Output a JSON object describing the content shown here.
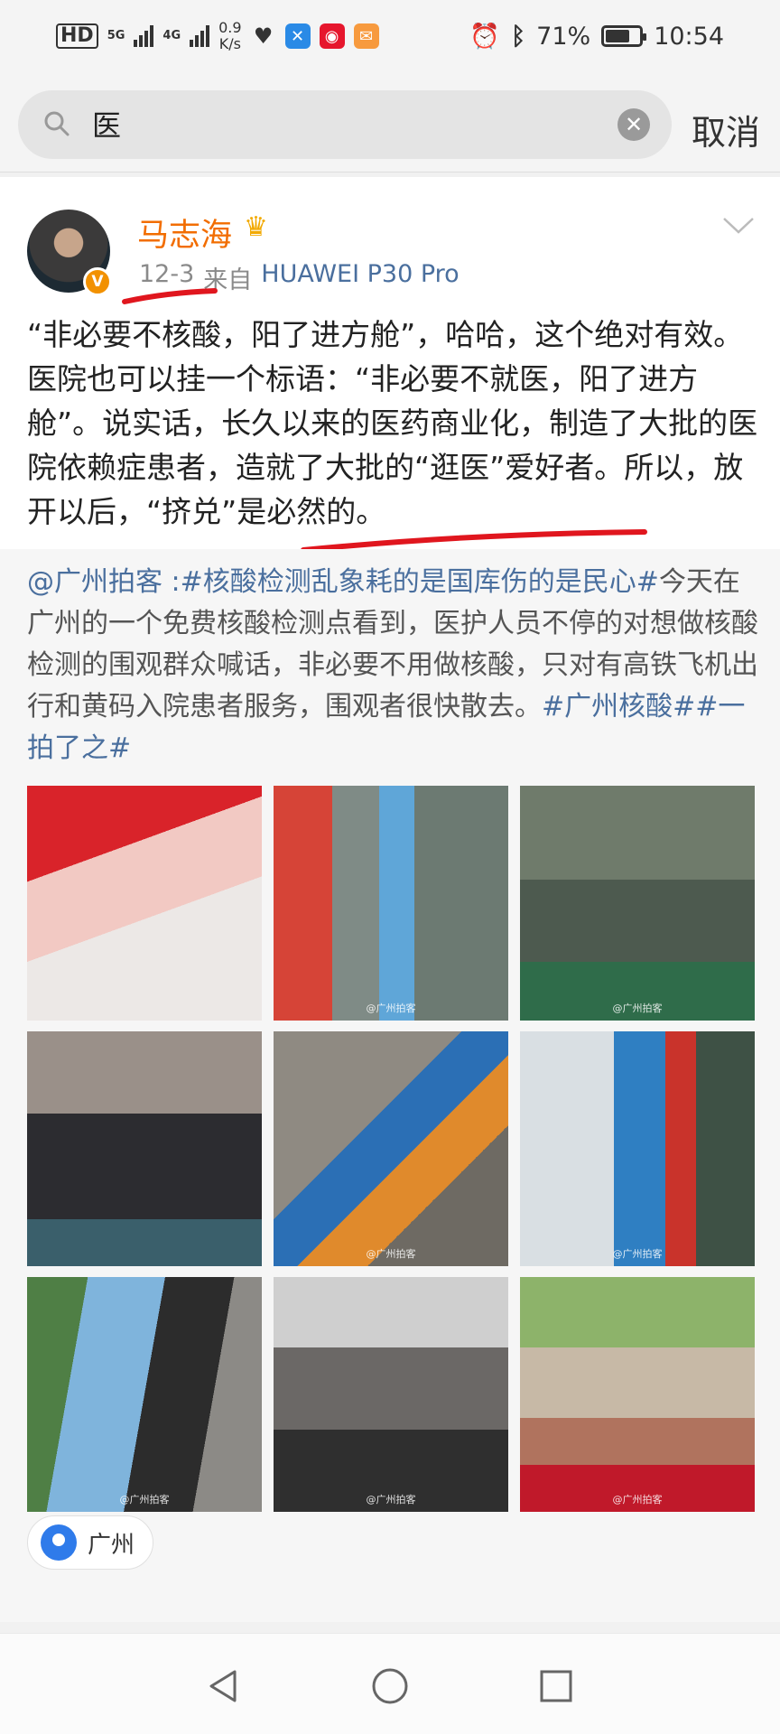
{
  "status_bar": {
    "left": {
      "hd": "HD",
      "net1": "5G",
      "net2": "4G",
      "speed_value": "0.9",
      "speed_unit": "K/s"
    },
    "battery": {
      "percent_text": "71%",
      "level": 0.71
    },
    "time": "10:54",
    "icons": [
      "alarm-icon",
      "bluetooth-icon",
      "heart-rate-icon",
      "app-icon",
      "weibo-icon",
      "chat-icon"
    ]
  },
  "search": {
    "value": "医",
    "cancel_label": "取消"
  },
  "post": {
    "author": "马志海",
    "date": "12-3",
    "source_prefix": "来自",
    "device": "HUAWEI P30 Pro",
    "text": "“非必要不核酸，阳了进方舱”，哈哈，这个绝对有效。医院也可以挂一个标语：“非必要不就医，阳了进方舱”。说实话，长久以来的医药商业化，制造了大批的医院依赖症患者，造就了大批的“逛医”爱好者。所以，放开以后，“挤兑”是必然的。"
  },
  "quote": {
    "mention": "@广州拍客",
    "separator": " :",
    "topic1": "#核酸检测乱象耗的是国库伤的是民心#",
    "body": "今天在广州的一个免费核酸检测点看到，医护人员不停的对想做核酸检测的围观群众喊话，非必要不用做核酸，只对有高铁飞机出行和黄码入院患者服务，围观者很快散去。",
    "topic2": "#广州核酸#",
    "topic3": "#一拍了之#"
  },
  "photos": [
    {
      "watermark": ""
    },
    {
      "watermark": "@广州拍客"
    },
    {
      "watermark": "@广州拍客"
    },
    {
      "watermark": ""
    },
    {
      "watermark": "@广州拍客"
    },
    {
      "watermark": "@广州拍客"
    },
    {
      "watermark": "@广州拍客"
    },
    {
      "watermark": "@广州拍客"
    },
    {
      "watermark": "@广州拍客"
    }
  ],
  "location": {
    "label": "广州"
  },
  "colors": {
    "username": "#f26d00",
    "link": "#4a6f9e",
    "annotation": "#e0161e"
  }
}
